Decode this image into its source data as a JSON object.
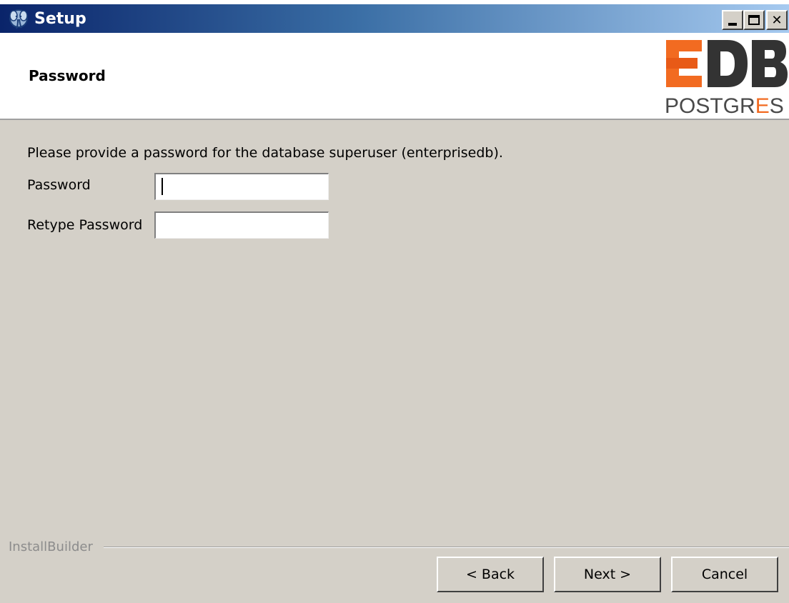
{
  "window": {
    "title": "Setup",
    "icon": "postgres-elephant-icon",
    "controls": {
      "minimize_icon": "minimize-icon",
      "maximize_icon": "maximize-icon",
      "close_label": "✕"
    }
  },
  "header": {
    "title": "Password",
    "logo": {
      "brand_letters": "EDB",
      "product_text_prefix": "POSTGR",
      "product_text_accent": "E",
      "product_text_suffix": "S",
      "colors": {
        "orange": "#f26b21",
        "orange_dark": "#e85a17",
        "dark": "#333333",
        "gray_text": "#4a4a4a"
      }
    }
  },
  "form": {
    "instructions": "Please provide a password for the database superuser (enterprisedb).",
    "password_label": "Password",
    "password_value": "",
    "retype_label": "Retype Password",
    "retype_value": ""
  },
  "footer": {
    "builder_label": "InstallBuilder",
    "back_label": "< Back",
    "next_label": "Next >",
    "cancel_label": "Cancel"
  },
  "colors": {
    "titlebar_start": "#0a246a",
    "titlebar_end": "#a6caf0",
    "dialog_bg": "#d4d0c8"
  }
}
